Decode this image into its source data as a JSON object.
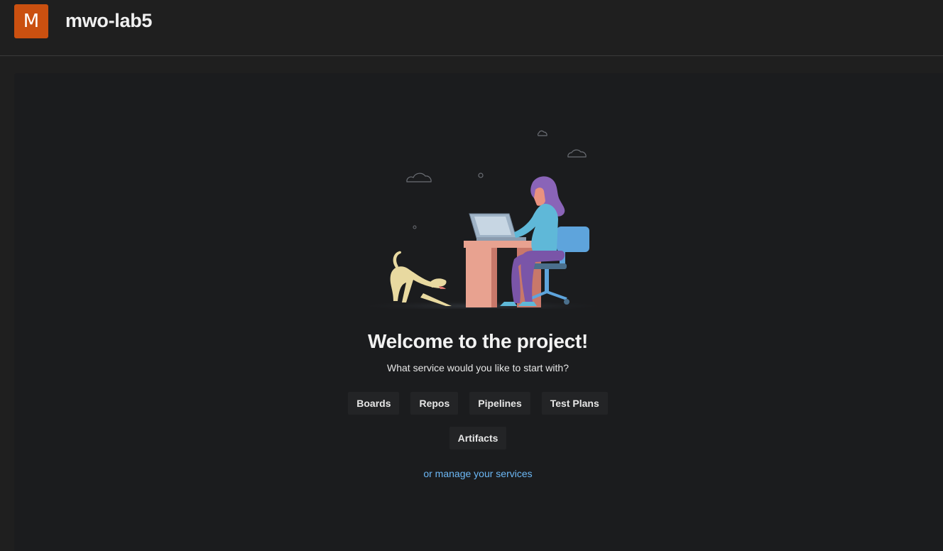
{
  "header": {
    "avatar_letter": "M",
    "project_name": "mwo-lab5"
  },
  "main": {
    "welcome_title": "Welcome to the project!",
    "subtitle": "What service would you like to start with?",
    "services": [
      {
        "label": "Boards"
      },
      {
        "label": "Repos"
      },
      {
        "label": "Pipelines"
      },
      {
        "label": "Test Plans"
      },
      {
        "label": "Artifacts"
      }
    ],
    "manage_link": "or manage your services"
  },
  "colors": {
    "avatar_bg": "#ca5010",
    "link": "#6cb8f6",
    "page_bg": "#1f1f1f",
    "panel_bg": "#1b1c1e"
  }
}
